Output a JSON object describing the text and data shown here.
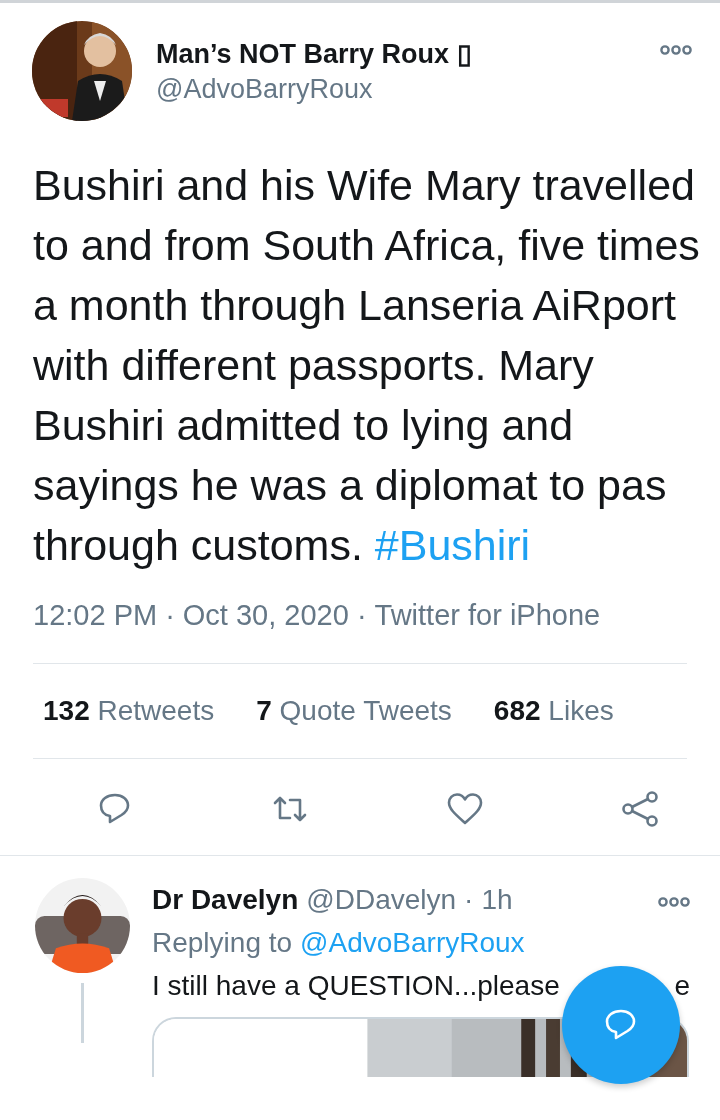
{
  "tweet": {
    "author": {
      "name": "Man’s NOT Barry Roux ▯",
      "handle": "@AdvoBarryRoux"
    },
    "text": "Bushiri and his Wife Mary travelled to and from South Africa, five times a month through Lanseria AiRport with different passports. Mary Bushiri admitted to lying and sayings he was a diplomat to pas through customs.",
    "hashtag": "#Bushiri",
    "time": "12:02 PM",
    "sep_1": "·",
    "date": "Oct 30, 2020",
    "sep_2": "·",
    "source": "Twitter for iPhone",
    "stats": [
      {
        "count": "132",
        "label": "Retweets"
      },
      {
        "count": "7",
        "label": "Quote Tweets"
      },
      {
        "count": "682",
        "label": "Likes"
      }
    ],
    "actions": [
      {
        "kind": "reply"
      },
      {
        "kind": "retweet"
      },
      {
        "kind": "like"
      },
      {
        "kind": "share"
      }
    ]
  },
  "reply": {
    "name": "Dr Davelyn",
    "handle": "@DDavelyn",
    "sep": "·",
    "age": "1h",
    "replying_label": "Replying to",
    "replying_to": "@AdvoBarryRoux",
    "text": "I still have a QUESTION...please",
    "text_tail": "e"
  },
  "compose_button": {
    "kind": "reply"
  }
}
